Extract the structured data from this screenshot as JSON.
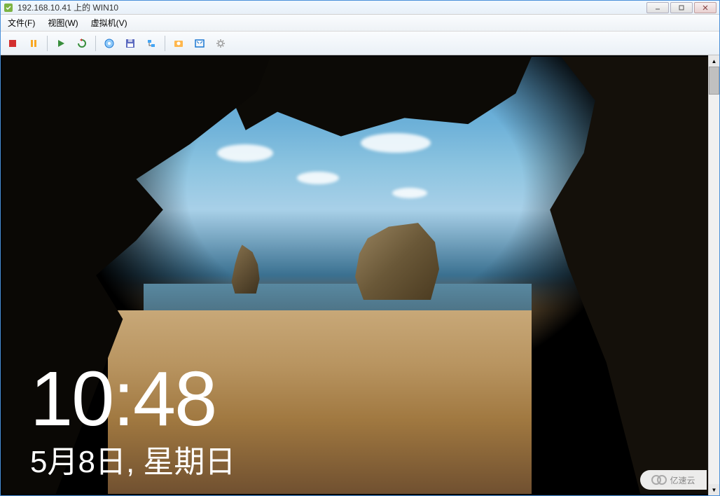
{
  "window": {
    "title": "192.168.10.41 上的 WIN10"
  },
  "menu": {
    "file": "文件(F)",
    "view": "视图(W)",
    "vm": "虚拟机(V)"
  },
  "toolbar": {
    "stop": "stop",
    "pause": "pause",
    "play": "play",
    "refresh": "refresh",
    "cdrom": "cdrom",
    "floppy": "floppy",
    "usb": "usb",
    "snapshot": "snapshot",
    "fullscreen": "fullscreen",
    "settings": "settings"
  },
  "lockscreen": {
    "time": "10:48",
    "date": "5月8日, 星期日"
  },
  "watermark": {
    "text": "亿速云"
  }
}
